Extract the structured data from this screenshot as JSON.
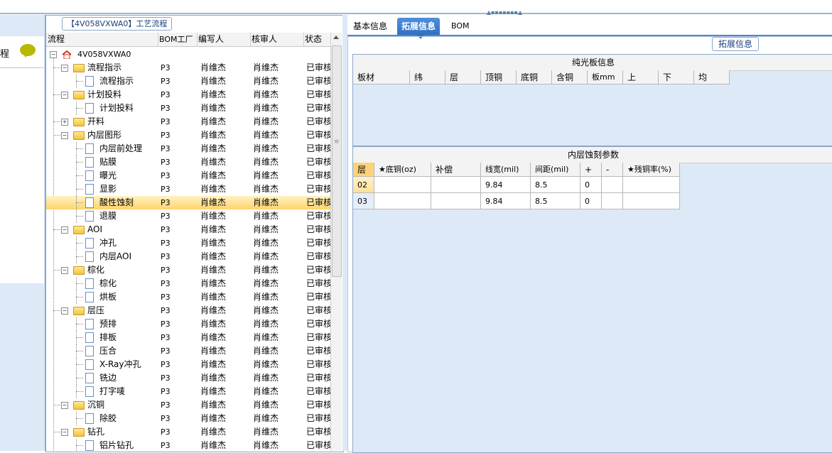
{
  "top_grip": "▲▪▪▪▪▪▪▪▲",
  "left_pane": {
    "row_text": "程",
    "chat_icon": "chat-bubble-icon"
  },
  "process": {
    "group_title": "【4V058VXWA0】工艺流程",
    "columns": [
      "流程",
      "BOM工厂",
      "编写人",
      "核审人",
      "状态"
    ],
    "root": "4V058VXWA0",
    "rows": [
      {
        "name": "流程指示",
        "level": 1,
        "type": "folder",
        "factory": "P3",
        "writer": "肖维杰",
        "reviewer": "肖维杰",
        "status": "已审核"
      },
      {
        "name": "流程指示",
        "level": 2,
        "type": "doc",
        "factory": "P3",
        "writer": "肖维杰",
        "reviewer": "肖维杰",
        "status": "已审核"
      },
      {
        "name": "计划投料",
        "level": 1,
        "type": "folder",
        "factory": "P3",
        "writer": "肖维杰",
        "reviewer": "肖维杰",
        "status": "已审核"
      },
      {
        "name": "计划投料",
        "level": 2,
        "type": "doc",
        "factory": "P3",
        "writer": "肖维杰",
        "reviewer": "肖维杰",
        "status": "已审核"
      },
      {
        "name": "开料",
        "level": 1,
        "type": "folder",
        "factory": "P3",
        "writer": "肖维杰",
        "reviewer": "肖维杰",
        "status": "已审核"
      },
      {
        "name": "内层图形",
        "level": 1,
        "type": "folder",
        "factory": "P3",
        "writer": "肖维杰",
        "reviewer": "肖维杰",
        "status": "已审核"
      },
      {
        "name": "内层前处理",
        "level": 2,
        "type": "doc",
        "factory": "P3",
        "writer": "肖维杰",
        "reviewer": "肖维杰",
        "status": "已审核"
      },
      {
        "name": "贴膜",
        "level": 2,
        "type": "doc",
        "factory": "P3",
        "writer": "肖维杰",
        "reviewer": "肖维杰",
        "status": "已审核"
      },
      {
        "name": "曝光",
        "level": 2,
        "type": "doc",
        "factory": "P3",
        "writer": "肖维杰",
        "reviewer": "肖维杰",
        "status": "已审核"
      },
      {
        "name": "显影",
        "level": 2,
        "type": "doc",
        "factory": "P3",
        "writer": "肖维杰",
        "reviewer": "肖维杰",
        "status": "已审核"
      },
      {
        "name": "酸性蚀刻",
        "level": 2,
        "type": "doc",
        "factory": "P3",
        "writer": "肖维杰",
        "reviewer": "肖维杰",
        "status": "已审核",
        "selected": true
      },
      {
        "name": "退膜",
        "level": 2,
        "type": "doc",
        "factory": "P3",
        "writer": "肖维杰",
        "reviewer": "肖维杰",
        "status": "已审核"
      },
      {
        "name": "AOI",
        "level": 1,
        "type": "folder",
        "factory": "P3",
        "writer": "肖维杰",
        "reviewer": "肖维杰",
        "status": "已审核"
      },
      {
        "name": "冲孔",
        "level": 2,
        "type": "doc",
        "factory": "P3",
        "writer": "肖维杰",
        "reviewer": "肖维杰",
        "status": "已审核"
      },
      {
        "name": "内层AOI",
        "level": 2,
        "type": "doc",
        "factory": "P3",
        "writer": "肖维杰",
        "reviewer": "肖维杰",
        "status": "已审核"
      },
      {
        "name": "棕化",
        "level": 1,
        "type": "folder",
        "factory": "P3",
        "writer": "肖维杰",
        "reviewer": "肖维杰",
        "status": "已审核"
      },
      {
        "name": "棕化",
        "level": 2,
        "type": "doc",
        "factory": "P3",
        "writer": "肖维杰",
        "reviewer": "肖维杰",
        "status": "已审核"
      },
      {
        "name": "烘板",
        "level": 2,
        "type": "doc",
        "factory": "P3",
        "writer": "肖维杰",
        "reviewer": "肖维杰",
        "status": "已审核"
      },
      {
        "name": "层压",
        "level": 1,
        "type": "folder",
        "factory": "P3",
        "writer": "肖维杰",
        "reviewer": "肖维杰",
        "status": "已审核"
      },
      {
        "name": "预排",
        "level": 2,
        "type": "doc",
        "factory": "P3",
        "writer": "肖维杰",
        "reviewer": "肖维杰",
        "status": "已审核"
      },
      {
        "name": "排板",
        "level": 2,
        "type": "doc",
        "factory": "P3",
        "writer": "肖维杰",
        "reviewer": "肖维杰",
        "status": "已审核"
      },
      {
        "name": "压合",
        "level": 2,
        "type": "doc",
        "factory": "P3",
        "writer": "肖维杰",
        "reviewer": "肖维杰",
        "status": "已审核"
      },
      {
        "name": "X-Ray冲孔",
        "level": 2,
        "type": "doc",
        "factory": "P3",
        "writer": "肖维杰",
        "reviewer": "肖维杰",
        "status": "已审核"
      },
      {
        "name": "铣边",
        "level": 2,
        "type": "doc",
        "factory": "P3",
        "writer": "肖维杰",
        "reviewer": "肖维杰",
        "status": "已审核"
      },
      {
        "name": "打字唛",
        "level": 2,
        "type": "doc",
        "factory": "P3",
        "writer": "肖维杰",
        "reviewer": "肖维杰",
        "status": "已审核"
      },
      {
        "name": "沉铜",
        "level": 1,
        "type": "folder",
        "factory": "P3",
        "writer": "肖维杰",
        "reviewer": "肖维杰",
        "status": "已审核"
      },
      {
        "name": "除胶",
        "level": 2,
        "type": "doc",
        "factory": "P3",
        "writer": "肖维杰",
        "reviewer": "肖维杰",
        "status": "已审核"
      },
      {
        "name": "钻孔",
        "level": 1,
        "type": "folder",
        "factory": "P3",
        "writer": "肖维杰",
        "reviewer": "肖维杰",
        "status": "已审核"
      },
      {
        "name": "铝片钻孔",
        "level": 2,
        "type": "doc",
        "factory": "P3",
        "writer": "肖维杰",
        "reviewer": "肖维杰",
        "status": "已审核"
      }
    ]
  },
  "right": {
    "tabs": [
      "基本信息",
      "拓展信息",
      "BOM"
    ],
    "active_tab": 1,
    "ext_title": "拓展信息",
    "plain_board": {
      "title": "纯光板信息",
      "columns": [
        "板材",
        "纬",
        "层",
        "顶铜",
        "底铜",
        "含铜",
        "板mm",
        "上",
        "下",
        "均"
      ]
    },
    "inner_etch": {
      "title": "内层蚀刻参数",
      "columns": [
        "层",
        "★底铜(oz)",
        "补偿",
        "线宽(mil)",
        "间距(mil)",
        "+",
        "-",
        "★残铜率(%)"
      ],
      "rows": [
        [
          "02",
          "",
          "",
          "9.84",
          "8.5",
          "0",
          "",
          ""
        ],
        [
          "03",
          "",
          "",
          "9.84",
          "8.5",
          "0",
          "",
          ""
        ]
      ]
    }
  }
}
